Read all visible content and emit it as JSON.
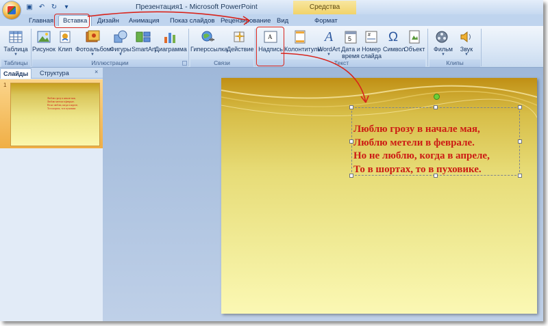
{
  "window": {
    "title": "Презентация1 - Microsoft PowerPoint",
    "context_tab": "Средства рисования"
  },
  "quick_access": {
    "icons": [
      "save-icon",
      "undo-icon",
      "redo-icon",
      "customize-icon"
    ]
  },
  "tabs": [
    "Главная",
    "Вставка",
    "Дизайн",
    "Анимация",
    "Показ слайдов",
    "Рецензирование",
    "Вид",
    "Формат"
  ],
  "active_tab": "Вставка",
  "ribbon": {
    "groups": {
      "tables": "Таблицы",
      "illustrations": "Иллюстрации",
      "links": "Связи",
      "text": "Текст",
      "media": "Клипы мультимедиа"
    },
    "buttons": {
      "table": "Таблица",
      "picture": "Рисунок",
      "clip": "Клип",
      "photo_album": "Фотоальбом",
      "shapes": "Фигуры",
      "smartart": "SmartArt",
      "chart": "Диаграмма",
      "hyperlink": "Гиперссылка",
      "action": "Действие",
      "textbox": "Надпись",
      "header_footer": "Колонтитулы",
      "wordart": "WordArt",
      "date_time_1": "Дата и",
      "date_time_2": "время",
      "slide_number_1": "Номер",
      "slide_number_2": "слайда",
      "symbol": "Символ",
      "object": "Объект",
      "movie": "Фильм",
      "sound": "Звук"
    }
  },
  "left_pane": {
    "tabs": [
      "Слайды",
      "Структура"
    ],
    "close": "×",
    "slide_number": "1"
  },
  "slide": {
    "lines": [
      "Люблю грозу в начале мая,",
      "Люблю метели в феврале.",
      "Но не люблю, когда в апреле,",
      "То в шортах, то в пуховике."
    ]
  },
  "colors": {
    "annotation": "#d8231b",
    "poem_text": "#cc1b14",
    "ribbon_text": "#15325e"
  }
}
